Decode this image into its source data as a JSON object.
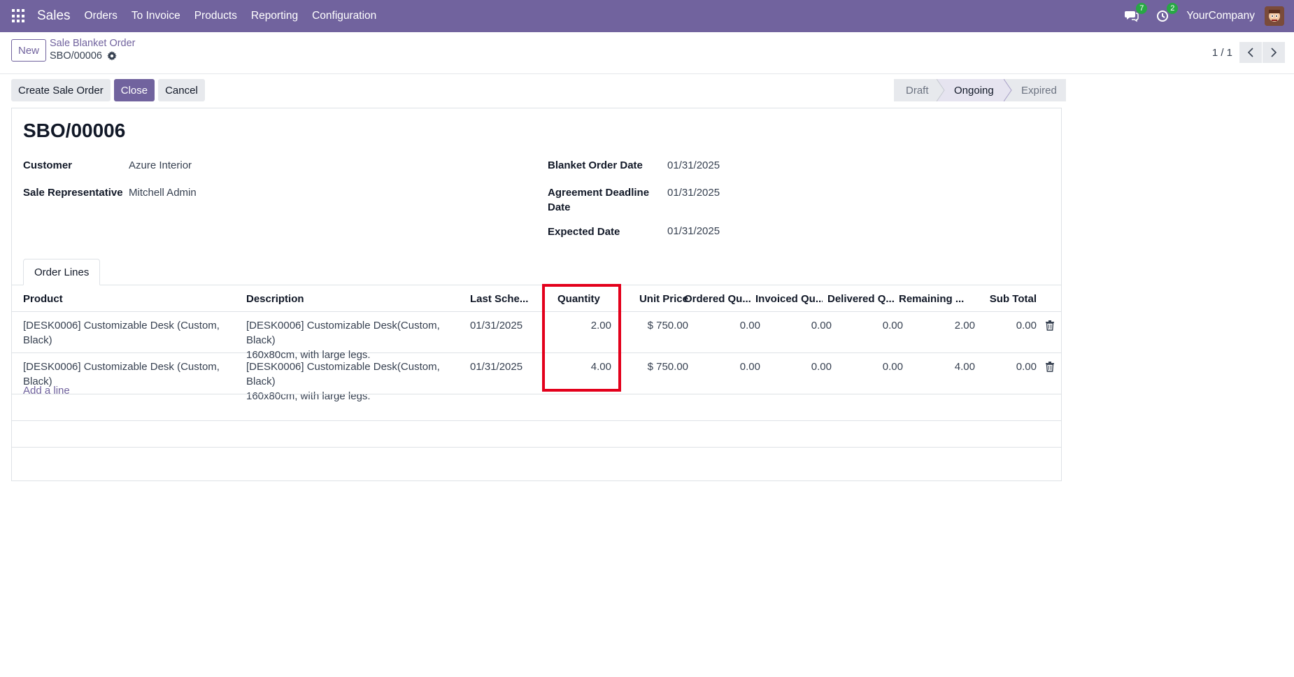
{
  "navbar": {
    "app_name": "Sales",
    "menu": [
      "Orders",
      "To Invoice",
      "Products",
      "Reporting",
      "Configuration"
    ],
    "messages_count": "7",
    "activities_count": "2",
    "company": "YourCompany",
    "color": "#71639e"
  },
  "control_panel": {
    "new_label": "New",
    "breadcrumb_parent": "Sale Blanket Order",
    "breadcrumb_current": "SBO/00006",
    "pager": "1 / 1"
  },
  "actions": {
    "create_sale_order": "Create Sale Order",
    "close": "Close",
    "cancel": "Cancel"
  },
  "statusbar": {
    "stages": [
      "Draft",
      "Ongoing",
      "Expired"
    ],
    "current": "Ongoing"
  },
  "form": {
    "title": "SBO/00006",
    "customer_label": "Customer",
    "customer": "Azure Interior",
    "salesrep_label": "Sale Representative",
    "salesrep": "Mitchell Admin",
    "blanket_date_label": "Blanket Order Date",
    "blanket_date": "01/31/2025",
    "deadline_label_line1": "Agreement Deadline",
    "deadline_label_line2": "Date",
    "deadline": "01/31/2025",
    "expected_label": "Expected Date",
    "expected": "01/31/2025"
  },
  "tabs": [
    "Order Lines"
  ],
  "table": {
    "headers": [
      "Product",
      "Description",
      "Last Sche...",
      "Quantity",
      "Unit Price",
      "Ordered Qu...",
      "Invoiced Qu...",
      "Delivered Q...",
      "Remaining ...",
      "Sub Total"
    ],
    "rows": [
      {
        "product": "[DESK0006] Customizable Desk (Custom, Black)",
        "desc1": "[DESK0006] Customizable Desk(Custom, Black)",
        "desc2": "160x80cm, with large legs.",
        "date": "01/31/2025",
        "quantity": "2.00",
        "unit_price": "$ 750.00",
        "ordered": "0.00",
        "invoiced": "0.00",
        "delivered": "0.00",
        "remaining": "2.00",
        "subtotal": "0.00"
      },
      {
        "product": "[DESK0006] Customizable Desk (Custom, Black)",
        "desc1": "[DESK0006] Customizable Desk(Custom, Black)",
        "desc2": "160x80cm, with large legs.",
        "date": "01/31/2025",
        "quantity": "4.00",
        "unit_price": "$ 750.00",
        "ordered": "0.00",
        "invoiced": "0.00",
        "delivered": "0.00",
        "remaining": "4.00",
        "subtotal": "0.00"
      }
    ],
    "add_line": "Add a line"
  }
}
